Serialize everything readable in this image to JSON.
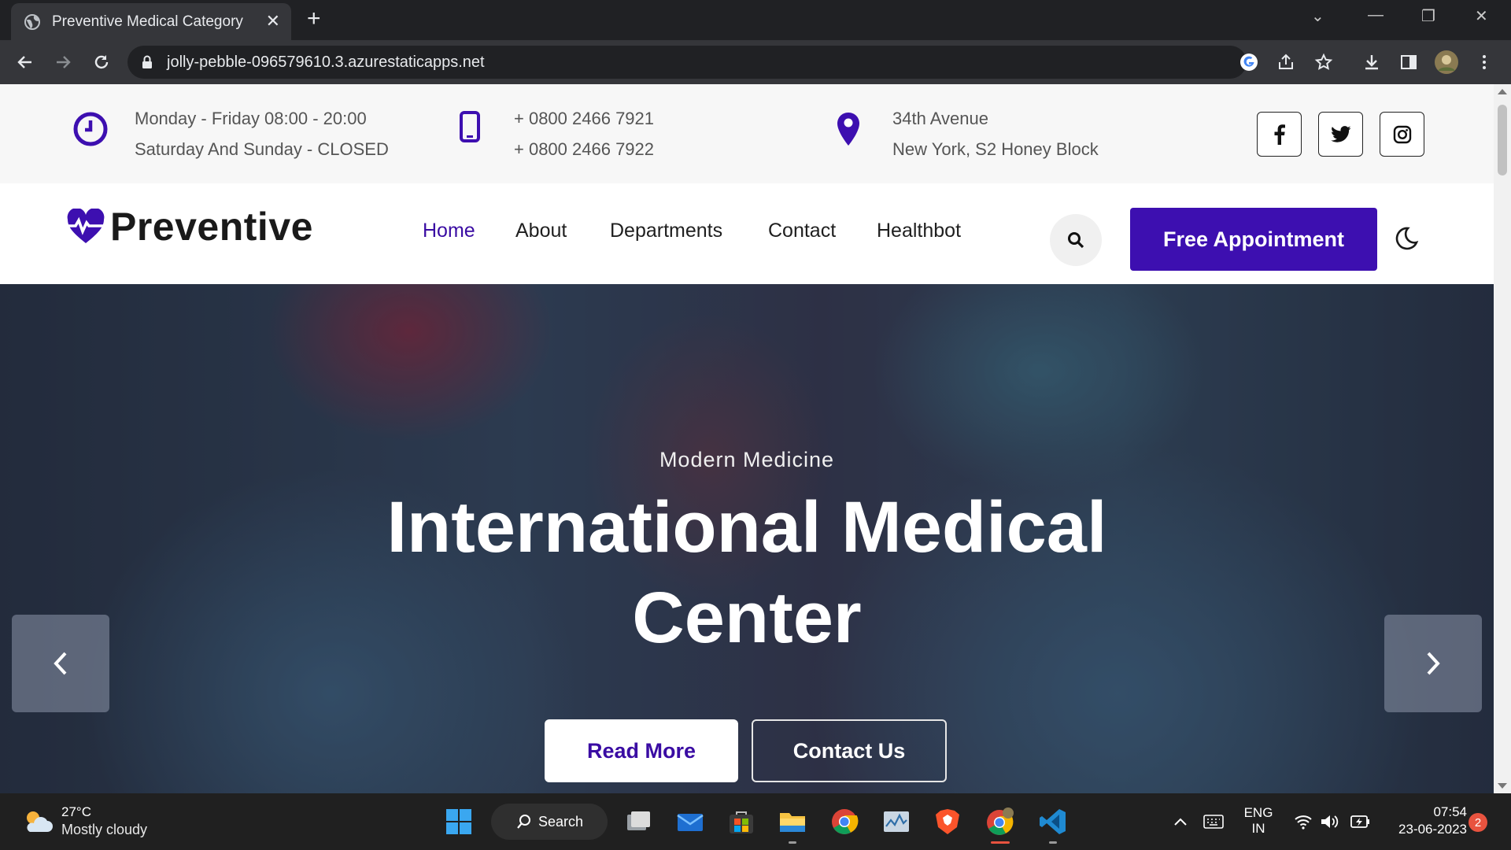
{
  "browser": {
    "tab_title": "Preventive Medical Category",
    "url": "jolly-pebble-096579610.3.azurestaticapps.net"
  },
  "topbar": {
    "hours_line1": "Monday - Friday 08:00 - 20:00",
    "hours_line2": "Saturday And Sunday - CLOSED",
    "phone_line1": "+ 0800 2466 7921",
    "phone_line2": "+ 0800 2466 7922",
    "address_line1": "34th Avenue",
    "address_line2": "New York, S2 Honey Block"
  },
  "navbar": {
    "logo": "Preventive",
    "menu": [
      "Home",
      "About",
      "Departments",
      "Contact",
      "Healthbot"
    ],
    "cta": "Free Appointment"
  },
  "hero": {
    "subtitle": "Modern Medicine",
    "title_line1": "International Medical",
    "title_line2": "Center",
    "read_more": "Read More",
    "contact_us": "Contact Us"
  },
  "taskbar": {
    "temperature": "27°C",
    "weather": "Mostly cloudy",
    "search": "Search",
    "lang1": "ENG",
    "lang2": "IN",
    "time": "07:54",
    "date": "23-06-2023",
    "notifications": "2"
  },
  "colors": {
    "brand": "#3d0fb0",
    "active_link": "#3a0ca3"
  }
}
